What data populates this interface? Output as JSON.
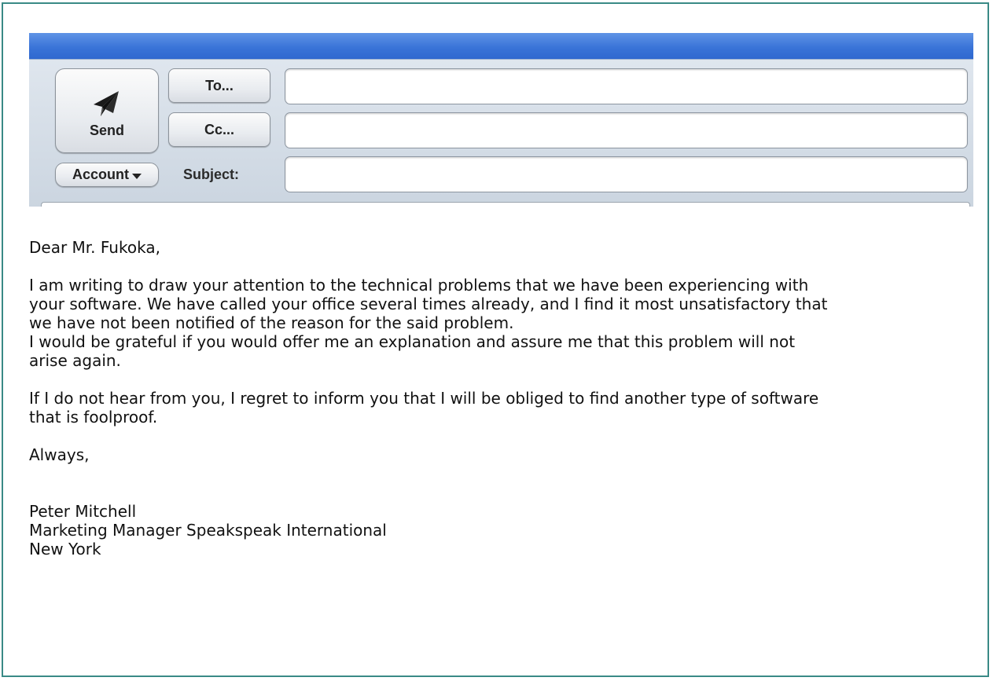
{
  "compose": {
    "send_label": "Send",
    "to_label": "To...",
    "cc_label": "Cc...",
    "account_label": "Account",
    "subject_label": "Subject:",
    "to_value": "",
    "cc_value": "",
    "subject_value": ""
  },
  "icons": {
    "send": "paper-plane-icon",
    "account_caret": "chevron-down-icon"
  },
  "colors": {
    "titlebar": "#3a74d8",
    "frame_border": "#3a8a86"
  },
  "letter": {
    "greeting": "Dear Mr. Fukoka,",
    "para1_line1": "I am writing to draw your attention to the technical problems that we have been experiencing with",
    "para1_line2": "your software. We have called your office several times already, and I find it most unsatisfactory that",
    "para1_line3": "we have not been notified of the reason for the said problem.",
    "para2_line1": "I would be grateful if you would offer me an explanation and assure me that this problem will not",
    "para2_line2": "arise again.",
    "para3_line1": "If I do not hear from you, I regret to inform you that I will be obliged to find another type of software",
    "para3_line2": "that is foolproof.",
    "closing": "Always,",
    "signature_name": "Peter Mitchell",
    "signature_title": "Marketing Manager Speakspeak International",
    "signature_city": "New York"
  }
}
